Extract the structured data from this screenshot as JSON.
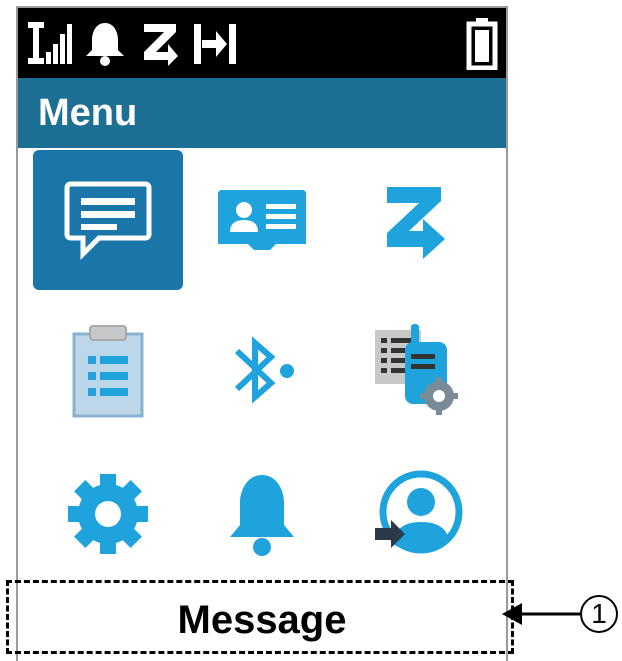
{
  "menu": {
    "title": "Menu"
  },
  "status_icons": [
    "signal-strength-icon",
    "bell-icon",
    "z-icon",
    "direct-mode-icon",
    "battery-icon"
  ],
  "tiles": [
    {
      "name": "messages-tile",
      "icon": "message-icon",
      "selected": true
    },
    {
      "name": "contacts-tile",
      "icon": "contact-card-icon",
      "selected": false
    },
    {
      "name": "scan-tile",
      "icon": "z-arrow-icon",
      "selected": false
    },
    {
      "name": "call-log-tile",
      "icon": "clipboard-list-icon",
      "selected": false
    },
    {
      "name": "bluetooth-tile",
      "icon": "bluetooth-icon",
      "selected": false
    },
    {
      "name": "radio-info-tile",
      "icon": "radio-settings-icon",
      "selected": false
    },
    {
      "name": "settings-tile",
      "icon": "gear-icon",
      "selected": false
    },
    {
      "name": "notifications-tile",
      "icon": "bell-icon",
      "selected": false
    },
    {
      "name": "user-login-tile",
      "icon": "user-login-icon",
      "selected": false
    }
  ],
  "selected_label": "Message",
  "callout": {
    "number": "1"
  },
  "colors": {
    "accent": "#1a75a8",
    "icon_blue": "#1ea3dc",
    "header": "#1e6f94"
  }
}
